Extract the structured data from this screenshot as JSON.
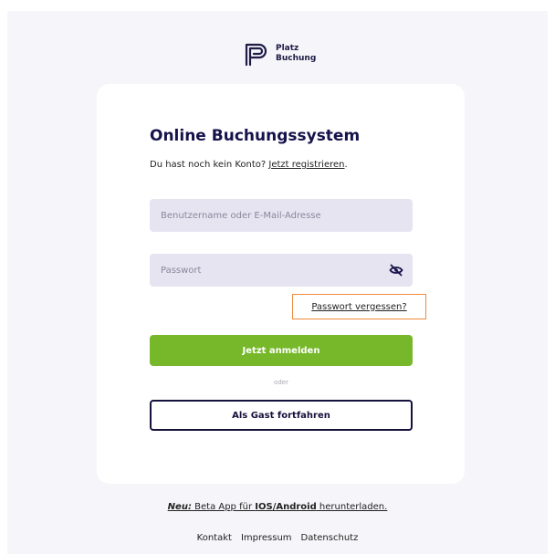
{
  "logo": {
    "icon": "platz-buchung-logo-icon",
    "line1": "Platz",
    "line2": "Buchung"
  },
  "login": {
    "title": "Online Buchungssystem",
    "no_account_text": "Du hast noch kein Konto? ",
    "register_link": "Jetzt registrieren",
    "register_suffix": ".",
    "username_placeholder": "Benutzername oder E-Mail-Adresse",
    "username_value": "",
    "password_placeholder": "Passwort",
    "password_value": "",
    "password_toggle_icon": "eye-slash-icon",
    "forgot_link": "Passwort vergessen?",
    "login_button": "Jetzt anmelden",
    "or_text": "oder",
    "guest_button": "Als Gast fortfahren"
  },
  "app_note": {
    "prefix": "Neu:",
    "text1": " Beta App für ",
    "platform_ios": "IOS",
    "slash": "/",
    "platform_android": "Android",
    "text2": " herunterladen."
  },
  "footer": {
    "links": [
      "Kontakt",
      "Impressum",
      "Datenschutz"
    ]
  },
  "colors": {
    "primary_dark": "#16124a",
    "green": "#76b82a",
    "input_bg": "#e6e4f0",
    "highlight": "#f08a3c",
    "page_bg": "#f6f6fa"
  }
}
